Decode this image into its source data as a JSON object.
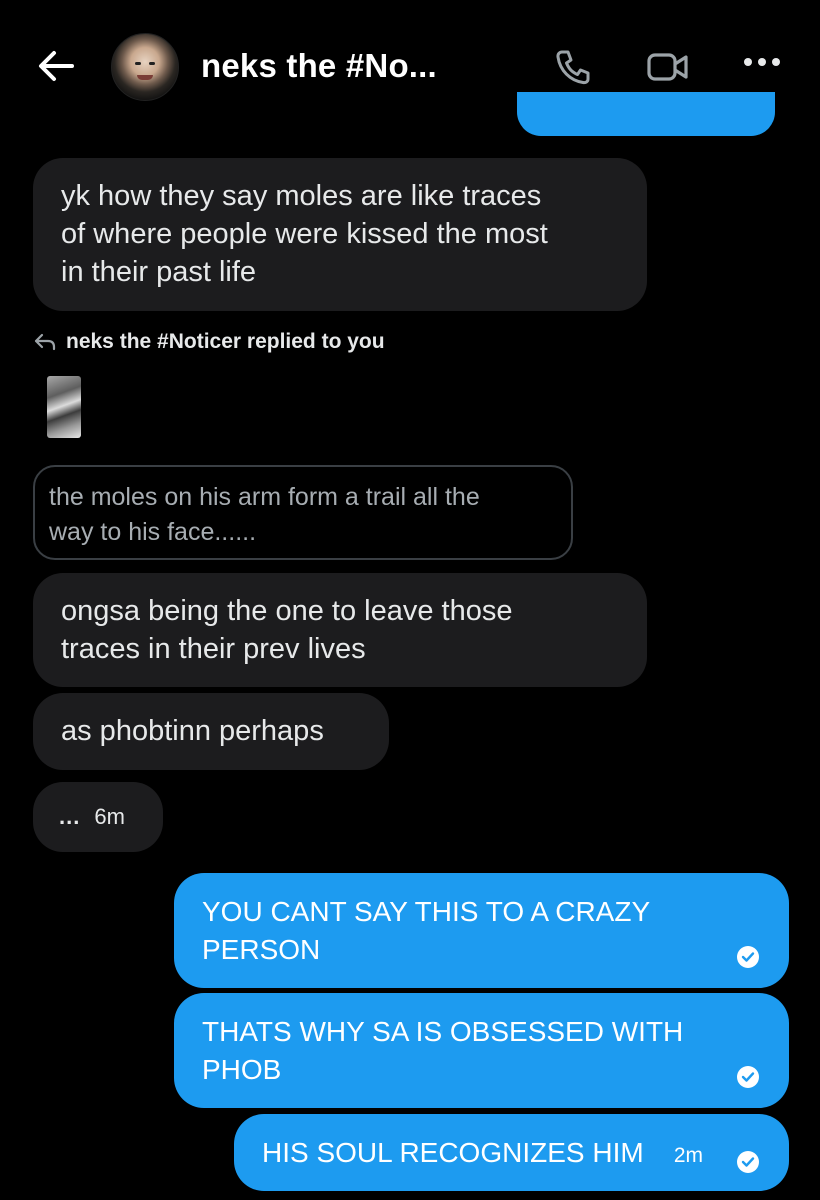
{
  "header": {
    "title": "neks the #No...",
    "avatar_alt": "neks the #Noticer avatar",
    "icons": {
      "back": "arrow-left-icon",
      "call": "phone-icon",
      "video": "video-camera-icon",
      "more": "more-options-icon"
    }
  },
  "messages": {
    "m1": {
      "lines": [
        "yk how they say moles are like traces",
        "of where people were kissed the most",
        "in their past life"
      ]
    },
    "reply": {
      "label": "neks the #Noticer replied to you",
      "icon": "reply-arrow-icon"
    },
    "quote": {
      "lines": [
        "the moles on his arm form a trail all the",
        "way to his face......"
      ]
    },
    "m2": {
      "lines": [
        "ongsa being the one to leave those",
        "traces in their prev lives"
      ]
    },
    "m3": {
      "text": "as phobtinn perhaps"
    },
    "typing": {
      "dots": "...",
      "time": "6m"
    },
    "o1": {
      "lines": [
        "YOU CANT SAY THIS TO A CRAZY",
        "PERSON"
      ]
    },
    "o2": {
      "lines": [
        "THATS WHY SA IS OBSESSED WITH",
        "PHOB"
      ]
    },
    "o3": {
      "text": "HIS SOUL RECOGNIZES HIM",
      "time": "2m"
    }
  },
  "colors": {
    "background": "#000000",
    "incoming_bubble": "#1c1c1e",
    "outgoing_bubble": "#1d9bf0",
    "quote_border": "#3a3f44"
  }
}
